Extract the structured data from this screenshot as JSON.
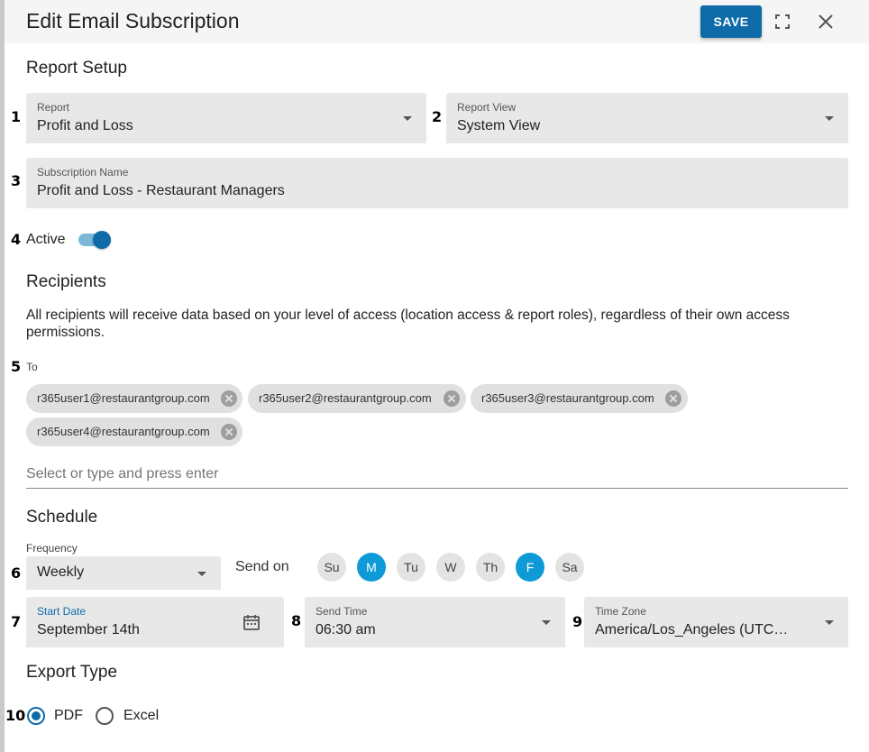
{
  "dialog": {
    "title": "Edit Email Subscription",
    "save_label": "SAVE",
    "expand_icon": "fullscreen-icon",
    "close_icon": "close-icon"
  },
  "report_setup": {
    "heading": "Report Setup",
    "report": {
      "num": "1",
      "label": "Report",
      "value": "Profit and Loss"
    },
    "report_view": {
      "num": "2",
      "label": "Report View",
      "value": "System View"
    },
    "subscription_name": {
      "num": "3",
      "label": "Subscription Name",
      "value": "Profit and Loss - Restaurant Managers"
    },
    "active": {
      "num": "4",
      "label": "Active",
      "checked": true
    }
  },
  "recipients": {
    "heading": "Recipients",
    "note": "All recipients will receive data based on your level of access (location access & report roles), regardless of their own access permissions.",
    "num": "5",
    "to_label": "To",
    "chips": [
      "r365user1@restaurantgroup.com",
      "r365user2@restaurantgroup.com",
      "r365user3@restaurantgroup.com",
      "r365user4@restaurantgroup.com"
    ],
    "input_placeholder": "Select or type and press enter"
  },
  "schedule": {
    "heading": "Schedule",
    "frequency": {
      "num": "6",
      "label": "Frequency",
      "value": "Weekly"
    },
    "send_on_label": "Send on",
    "days": [
      {
        "label": "Su",
        "selected": false
      },
      {
        "label": "M",
        "selected": true
      },
      {
        "label": "Tu",
        "selected": false
      },
      {
        "label": "W",
        "selected": false
      },
      {
        "label": "Th",
        "selected": false
      },
      {
        "label": "F",
        "selected": true
      },
      {
        "label": "Sa",
        "selected": false
      }
    ],
    "start_date": {
      "num": "7",
      "label": "Start Date",
      "value": "September 14th"
    },
    "send_time": {
      "num": "8",
      "label": "Send Time",
      "value": "06:30 am"
    },
    "time_zone": {
      "num": "9",
      "label": "Time Zone",
      "value": "America/Los_Angeles (UTC…"
    }
  },
  "export_type": {
    "heading": "Export Type",
    "num": "10",
    "options": [
      {
        "label": "PDF",
        "selected": true
      },
      {
        "label": "Excel",
        "selected": false
      }
    ]
  },
  "colors": {
    "primary": "#0e6ba8",
    "day_selected": "#0d9ad6",
    "field_bg": "#e8e8e8",
    "chip_bg": "#e0e0e0"
  }
}
